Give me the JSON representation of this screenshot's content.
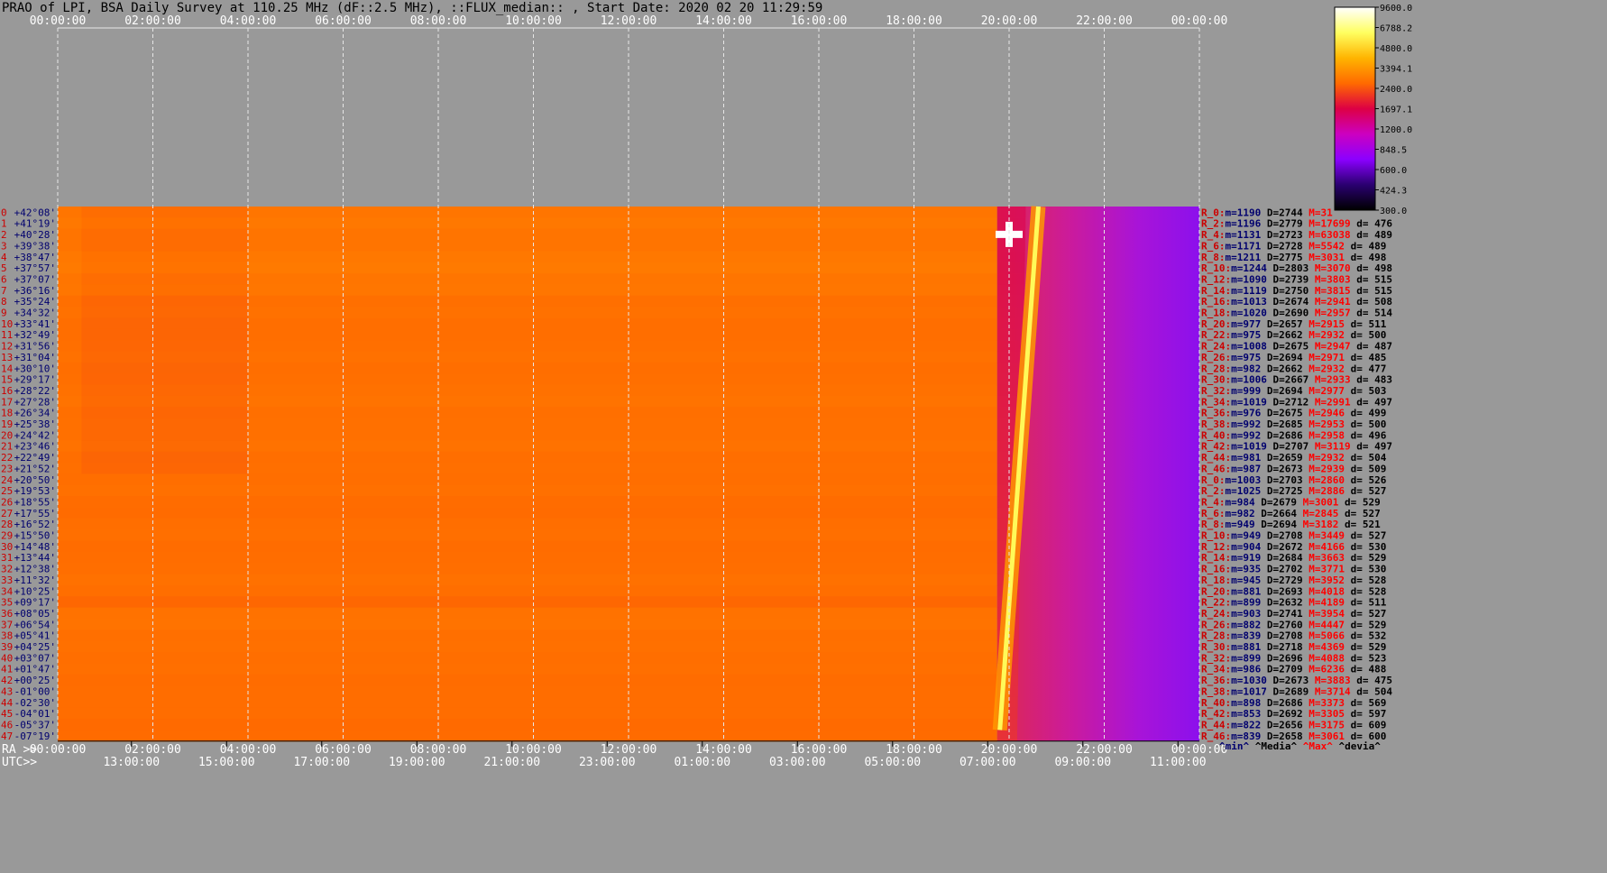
{
  "title": "PRAO of LPI, BSA Daily Survey at 110.25 MHz (dF::2.5 MHz), ::FLUX_median:: , Start Date: 2020 02 20 11:29:59",
  "colors": {
    "background": "#999999",
    "grid": "#e6e6e6",
    "axis_text": "#ffffff",
    "ray_index": "#cc0000",
    "declination": "#00006e",
    "stats_min": "#00006e",
    "stats_median": "#000000",
    "stats_max": "#ff0000",
    "stats_dev": "#000000"
  },
  "colormap": [
    "#000000",
    "#2a0070",
    "#8b00ff",
    "#cc00c0",
    "#dd0044",
    "#ff6a00",
    "#ffb400",
    "#ffff60",
    "#ffffff"
  ],
  "chart_data": {
    "type": "heatmap",
    "xlabel_top": "",
    "x_ticks_top": [
      "00:00:00",
      "02:00:00",
      "04:00:00",
      "06:00:00",
      "08:00:00",
      "10:00:00",
      "12:00:00",
      "14:00:00",
      "16:00:00",
      "18:00:00",
      "20:00:00",
      "22:00:00",
      "00:00:00"
    ],
    "ra_label": "RA >>",
    "x_ticks_ra": [
      "00:00:00",
      "02:00:00",
      "04:00:00",
      "06:00:00",
      "08:00:00",
      "10:00:00",
      "12:00:00",
      "14:00:00",
      "16:00:00",
      "18:00:00",
      "20:00:00",
      "22:00:00",
      "00:00:00"
    ],
    "utc_label": "UTC>>",
    "x_ticks_utc": [
      "13:00:00",
      "15:00:00",
      "17:00:00",
      "19:00:00",
      "21:00:00",
      "23:00:00",
      "01:00:00",
      "03:00:00",
      "05:00:00",
      "07:00:00",
      "09:00:00",
      "11:00:00"
    ],
    "x_range_hours": [
      0,
      24
    ],
    "colorbar_ticks": [
      "9600.0",
      "6788.2",
      "4800.0",
      "3394.1",
      "2400.0",
      "1697.1",
      "1200.0",
      "848.5",
      "600.0",
      "424.3",
      "300.0"
    ],
    "colorbar_range": [
      300,
      9600
    ],
    "colorbar_scale": "log",
    "ray_indices": [
      "0",
      "1",
      "2",
      "3",
      "4",
      "5",
      "6",
      "7",
      "8",
      "9",
      "10",
      "11",
      "12",
      "13",
      "14",
      "15",
      "16",
      "17",
      "18",
      "19",
      "20",
      "21",
      "22",
      "23",
      "24",
      "25",
      "26",
      "27",
      "28",
      "29",
      "30",
      "31",
      "32",
      "33",
      "34",
      "35",
      "36",
      "37",
      "38",
      "39",
      "40",
      "41",
      "42",
      "43",
      "44",
      "45",
      "46",
      "47",
      "0",
      "1",
      "2",
      "3",
      "4",
      "5",
      "6",
      "7",
      "8",
      "9",
      "10",
      "11",
      "12",
      "13",
      "14",
      "15",
      "16",
      "17",
      "18",
      "19",
      "20",
      "21",
      "22",
      "23",
      "24",
      "25",
      "26",
      "27",
      "28",
      "29",
      "30",
      "31",
      "32",
      "33",
      "34",
      "35",
      "36",
      "37",
      "38",
      "39",
      "40",
      "41",
      "42",
      "43",
      "44",
      "45",
      "46",
      "47"
    ],
    "declinations": [
      "+42°08'",
      "+41°19'",
      "+40°28'",
      "+39°38'",
      "+38°47'",
      "+37°57'",
      "+37°07'",
      "+36°16'",
      "+35°24'",
      "+34°32'",
      "+33°41'",
      "+32°49'",
      "+31°56'",
      "+31°04'",
      "+30°10'",
      "+29°17'",
      "+28°22'",
      "+27°28'",
      "+26°34'",
      "+25°38'",
      "+24°42'",
      "+23°46'",
      "+22°49'",
      "+21°52'",
      "+20°50'",
      "+19°53'",
      "+18°55'",
      "+17°55'",
      "+16°52'",
      "+15°50'",
      "+14°48'",
      "+13°44'",
      "+12°38'",
      "+11°32'",
      "+10°25'",
      "+09°17'",
      "+08°05'",
      "+06°54'",
      "+05°41'",
      "+04°25'",
      "+03°07'",
      "+01°47'",
      "+00°25'",
      "-01°00'",
      "-02°30'",
      "-04°01'",
      "-05°37'",
      "-07°19'"
    ],
    "stats": [
      {
        "ray": "R_0:",
        "min": "m=1190",
        "median": "D=2744",
        "max": "M=31",
        "dev": ""
      },
      {
        "ray": "R_2:",
        "min": "m=1196",
        "median": "D=2779",
        "max": "M=17699",
        "dev": "d= 476"
      },
      {
        "ray": "R_4:",
        "min": "m=1131",
        "median": "D=2723",
        "max": "M=63038",
        "dev": "d= 489"
      },
      {
        "ray": "R_6:",
        "min": "m=1171",
        "median": "D=2728",
        "max": "M=5542",
        "dev": "d= 489"
      },
      {
        "ray": "R_8:",
        "min": "m=1211",
        "median": "D=2775",
        "max": "M=3031",
        "dev": "d= 498"
      },
      {
        "ray": "R_10:",
        "min": "m=1244",
        "median": "D=2803",
        "max": "M=3070",
        "dev": "d= 498"
      },
      {
        "ray": "R_12:",
        "min": "m=1090",
        "median": "D=2739",
        "max": "M=3803",
        "dev": "d= 515"
      },
      {
        "ray": "R_14:",
        "min": "m=1119",
        "median": "D=2750",
        "max": "M=3815",
        "dev": "d= 515"
      },
      {
        "ray": "R_16:",
        "min": "m=1013",
        "median": "D=2674",
        "max": "M=2941",
        "dev": "d= 508"
      },
      {
        "ray": "R_18:",
        "min": "m=1020",
        "median": "D=2690",
        "max": "M=2957",
        "dev": "d= 514"
      },
      {
        "ray": "R_20:",
        "min": "m=977",
        "median": "D=2657",
        "max": "M=2915",
        "dev": "d= 511"
      },
      {
        "ray": "R_22:",
        "min": "m=975",
        "median": "D=2662",
        "max": "M=2932",
        "dev": "d= 500"
      },
      {
        "ray": "R_24:",
        "min": "m=1008",
        "median": "D=2675",
        "max": "M=2947",
        "dev": "d= 487"
      },
      {
        "ray": "R_26:",
        "min": "m=975",
        "median": "D=2694",
        "max": "M=2971",
        "dev": "d= 485"
      },
      {
        "ray": "R_28:",
        "min": "m=982",
        "median": "D=2662",
        "max": "M=2932",
        "dev": "d= 477"
      },
      {
        "ray": "R_30:",
        "min": "m=1006",
        "median": "D=2667",
        "max": "M=2933",
        "dev": "d= 483"
      },
      {
        "ray": "R_32:",
        "min": "m=999",
        "median": "D=2694",
        "max": "M=2977",
        "dev": "d= 503"
      },
      {
        "ray": "R_34:",
        "min": "m=1019",
        "median": "D=2712",
        "max": "M=2991",
        "dev": "d= 497"
      },
      {
        "ray": "R_36:",
        "min": "m=976",
        "median": "D=2675",
        "max": "M=2946",
        "dev": "d= 499"
      },
      {
        "ray": "R_38:",
        "min": "m=992",
        "median": "D=2685",
        "max": "M=2953",
        "dev": "d= 500"
      },
      {
        "ray": "R_40:",
        "min": "m=992",
        "median": "D=2686",
        "max": "M=2958",
        "dev": "d= 496"
      },
      {
        "ray": "R_42:",
        "min": "m=1019",
        "median": "D=2707",
        "max": "M=3119",
        "dev": "d= 497"
      },
      {
        "ray": "R_44:",
        "min": "m=981",
        "median": "D=2659",
        "max": "M=2932",
        "dev": "d= 504"
      },
      {
        "ray": "R_46:",
        "min": "m=987",
        "median": "D=2673",
        "max": "M=2939",
        "dev": "d= 509"
      },
      {
        "ray": "R_0:",
        "min": "m=1003",
        "median": "D=2703",
        "max": "M=2860",
        "dev": "d= 526"
      },
      {
        "ray": "R_2:",
        "min": "m=1025",
        "median": "D=2725",
        "max": "M=2886",
        "dev": "d= 527"
      },
      {
        "ray": "R_4:",
        "min": "m=984",
        "median": "D=2679",
        "max": "M=3001",
        "dev": "d= 529"
      },
      {
        "ray": "R_6:",
        "min": "m=982",
        "median": "D=2664",
        "max": "M=2845",
        "dev": "d= 527"
      },
      {
        "ray": "R_8:",
        "min": "m=949",
        "median": "D=2694",
        "max": "M=3182",
        "dev": "d= 521"
      },
      {
        "ray": "R_10:",
        "min": "m=949",
        "median": "D=2708",
        "max": "M=3449",
        "dev": "d= 527"
      },
      {
        "ray": "R_12:",
        "min": "m=904",
        "median": "D=2672",
        "max": "M=4166",
        "dev": "d= 530"
      },
      {
        "ray": "R_14:",
        "min": "m=919",
        "median": "D=2684",
        "max": "M=3663",
        "dev": "d= 529"
      },
      {
        "ray": "R_16:",
        "min": "m=935",
        "median": "D=2702",
        "max": "M=3771",
        "dev": "d= 530"
      },
      {
        "ray": "R_18:",
        "min": "m=945",
        "median": "D=2729",
        "max": "M=3952",
        "dev": "d= 528"
      },
      {
        "ray": "R_20:",
        "min": "m=881",
        "median": "D=2693",
        "max": "M=4018",
        "dev": "d= 528"
      },
      {
        "ray": "R_22:",
        "min": "m=899",
        "median": "D=2632",
        "max": "M=4189",
        "dev": "d= 511"
      },
      {
        "ray": "R_24:",
        "min": "m=903",
        "median": "D=2741",
        "max": "M=3954",
        "dev": "d= 527"
      },
      {
        "ray": "R_26:",
        "min": "m=882",
        "median": "D=2760",
        "max": "M=4447",
        "dev": "d= 529"
      },
      {
        "ray": "R_28:",
        "min": "m=839",
        "median": "D=2708",
        "max": "M=5066",
        "dev": "d= 532"
      },
      {
        "ray": "R_30:",
        "min": "m=881",
        "median": "D=2718",
        "max": "M=4369",
        "dev": "d= 529"
      },
      {
        "ray": "R_32:",
        "min": "m=899",
        "median": "D=2696",
        "max": "M=4088",
        "dev": "d= 523"
      },
      {
        "ray": "R_34:",
        "min": "m=986",
        "median": "D=2709",
        "max": "M=6236",
        "dev": "d= 488"
      },
      {
        "ray": "R_36:",
        "min": "m=1030",
        "median": "D=2673",
        "max": "M=3883",
        "dev": "d= 475"
      },
      {
        "ray": "R_38:",
        "min": "m=1017",
        "median": "D=2689",
        "max": "M=3714",
        "dev": "d= 504"
      },
      {
        "ray": "R_40:",
        "min": "m=898",
        "median": "D=2686",
        "max": "M=3373",
        "dev": "d= 569"
      },
      {
        "ray": "R_42:",
        "min": "m=853",
        "median": "D=2692",
        "max": "M=3305",
        "dev": "d= 597"
      },
      {
        "ray": "R_44:",
        "min": "m=822",
        "median": "D=2656",
        "max": "M=3175",
        "dev": "d= 609"
      },
      {
        "ray": "R_46:",
        "min": "m=839",
        "median": "D=2658",
        "max": "M=3061",
        "dev": "d= 600"
      }
    ],
    "stats_footer": [
      "^min^",
      "^Media^",
      "^Max^",
      "^devia^"
    ],
    "regions": {
      "data_start_hours": 0,
      "data_gap_hours": [
        19.75,
        24
      ],
      "night_segment_start_hours": 19.75,
      "orange_level": 2750,
      "magenta_level": 1250,
      "purple_level": 880
    },
    "sources": [
      {
        "name": "",
        "track_start_hours": [
          20.35,
          0
        ],
        "track_end_hours": [
          19.9,
          47
        ],
        "peak_flux": 6000
      },
      {
        "name": "",
        "point_hours": 20.0,
        "ray": 2,
        "peak_flux": 9600
      }
    ]
  }
}
